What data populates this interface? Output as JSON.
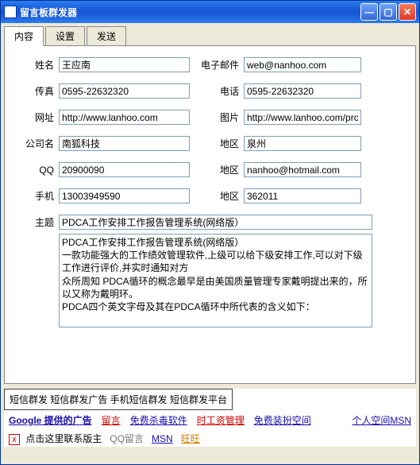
{
  "window": {
    "title": "留言板群发器"
  },
  "tabs": {
    "t0": "内容",
    "t1": "设置",
    "t2": "发送"
  },
  "form": {
    "name_label": "姓名",
    "name_value": "王应南",
    "email_label": "电子邮件",
    "email_value": "web@nanhoo.com",
    "fax_label": "传真",
    "fax_value": "0595-22632320",
    "phone_label": "电话",
    "phone_value": "0595-22632320",
    "url_label": "网址",
    "url_value": "http://www.lanhoo.com",
    "pic_label": "图片",
    "pic_value": "http://www.lanhoo.com/pro/F",
    "company_label": "公司名",
    "company_value": "南狐科技",
    "region_label": "地区",
    "region_value": "泉州",
    "qq_label": "QQ",
    "qq_value": "20900090",
    "region2_label": "地区",
    "region2_value": "nanhoo@hotmail.com",
    "mobile_label": "手机",
    "mobile_value": "13003949590",
    "region3_label": "地区",
    "region3_value": "362011",
    "subject_label": "主题",
    "subject_value": "PDCA工作安排工作报告管理系统(网络版）",
    "body_value": "PDCA工作安排工作报告管理系统(网络版）\n一款功能强大的工作绩效管理软件,上级可以给下级安排工作,可以对下级工作进行评价,并实时通知对方\n众所周知 PDCA循环的概念最早是由美国质量管理专家戴明提出来的，所以又称为戴明环。\nPDCA四个英文字母及其在PDCA循环中所代表的含义如下："
  },
  "ads": {
    "toprow": "短信群发  短信群发广告  手机短信群发  短信群发平台",
    "google": "Google 提供的广告",
    "l1": "留言",
    "l2": "免费杀毒软件",
    "l3": "时工资管理",
    "l4": "免费装扮空间",
    "l5": "个人空间MSN",
    "contact": "点击这里联系版主",
    "qqmsg": "QQ留言",
    "msn": "MSN",
    "ww": "旺旺"
  }
}
